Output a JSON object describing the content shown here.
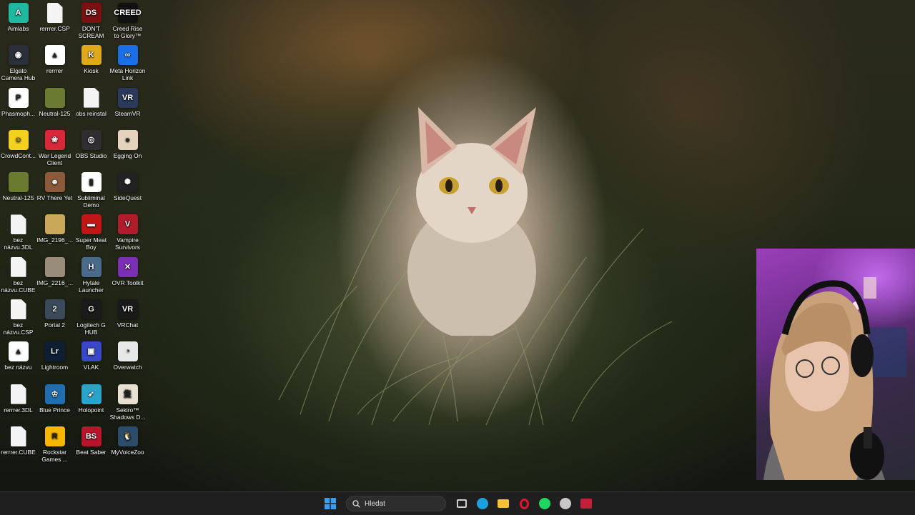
{
  "desktop": {
    "icons": [
      {
        "label": "Aimlabs",
        "kind": "app",
        "glyph": "A",
        "color": "#1fb8a0"
      },
      {
        "label": "rerrrer.CSP",
        "kind": "file",
        "glyph": "",
        "color": "#f4f4f4"
      },
      {
        "label": "DON'T SCREAM",
        "kind": "app",
        "glyph": "DS",
        "color": "#7a1010"
      },
      {
        "label": "Creed Rise to Glory™",
        "kind": "app",
        "glyph": "CREED",
        "color": "#111111"
      },
      {
        "label": "Elgato Camera Hub",
        "kind": "app",
        "glyph": "◉",
        "color": "#2a2f3a"
      },
      {
        "label": "rerrrer",
        "kind": "app",
        "glyph": "▲",
        "color": "#ffffff"
      },
      {
        "label": "Kiosk",
        "kind": "app",
        "glyph": "K",
        "color": "#e0a91c"
      },
      {
        "label": "Meta Horizon Link",
        "kind": "app",
        "glyph": "∞",
        "color": "#1a6fe8"
      },
      {
        "label": "Phasmoph...",
        "kind": "app",
        "glyph": "P",
        "color": "#ffffff"
      },
      {
        "label": "Neutral-125",
        "kind": "app",
        "glyph": "",
        "color": "#6a7a30"
      },
      {
        "label": "obs reinstal",
        "kind": "file",
        "glyph": "",
        "color": "#f4f4f4"
      },
      {
        "label": "SteamVR",
        "kind": "app",
        "glyph": "VR",
        "color": "#2b3a5c"
      },
      {
        "label": "CrowdCont...",
        "kind": "app",
        "glyph": "☺",
        "color": "#f2d21c"
      },
      {
        "label": "War Legend Client",
        "kind": "app",
        "glyph": "❀",
        "color": "#d8283a"
      },
      {
        "label": "OBS Studio",
        "kind": "app",
        "glyph": "◎",
        "color": "#302e31"
      },
      {
        "label": "Egging On",
        "kind": "app",
        "glyph": "●",
        "color": "#e6d3bd"
      },
      {
        "label": "Neutral-125",
        "kind": "app",
        "glyph": "",
        "color": "#6a7a30"
      },
      {
        "label": "RV There Yet",
        "kind": "app",
        "glyph": "☻",
        "color": "#8a5a3a"
      },
      {
        "label": "Subliminal Demo",
        "kind": "app",
        "glyph": "▮",
        "color": "#ffffff"
      },
      {
        "label": "SideQuest",
        "kind": "app",
        "glyph": "✺",
        "color": "#222222"
      },
      {
        "label": "bez názvu.3DL",
        "kind": "file",
        "glyph": "",
        "color": "#f4f4f4"
      },
      {
        "label": "IMG_2196_...",
        "kind": "app",
        "glyph": "",
        "color": "#c9a85a"
      },
      {
        "label": "Super Meat Boy",
        "kind": "app",
        "glyph": "▬",
        "color": "#c01616"
      },
      {
        "label": "Vampire Survivors",
        "kind": "app",
        "glyph": "V",
        "color": "#b01c2a"
      },
      {
        "label": "bez názvu.CUBE",
        "kind": "file",
        "glyph": "",
        "color": "#f4f4f4"
      },
      {
        "label": "IMG_2216_...",
        "kind": "app",
        "glyph": "",
        "color": "#9a8c7a"
      },
      {
        "label": "Hytale Launcher",
        "kind": "app",
        "glyph": "H",
        "color": "#4a6a8a"
      },
      {
        "label": "OVR Toolkit",
        "kind": "app",
        "glyph": "✕",
        "color": "#7b2fb5"
      },
      {
        "label": "bez názvu.CSP",
        "kind": "file",
        "glyph": "",
        "color": "#f4f4f4"
      },
      {
        "label": "Portal 2",
        "kind": "app",
        "glyph": "2",
        "color": "#3a4a5a"
      },
      {
        "label": "Logitech G HUB",
        "kind": "app",
        "glyph": "G",
        "color": "#1a1a1a"
      },
      {
        "label": "VRChat",
        "kind": "app",
        "glyph": "VR",
        "color": "#1a1a1a"
      },
      {
        "label": "bez názvu",
        "kind": "app",
        "glyph": "▲",
        "color": "#ffffff"
      },
      {
        "label": "Lightroom",
        "kind": "app",
        "glyph": "Lr",
        "color": "#0c1f33"
      },
      {
        "label": "VLAK",
        "kind": "app",
        "glyph": "▣",
        "color": "#3a48c8"
      },
      {
        "label": "Overwatch",
        "kind": "app",
        "glyph": "◔",
        "color": "#e8e8e8"
      },
      {
        "label": "rerrrer.3DL",
        "kind": "file",
        "glyph": "",
        "color": "#f4f4f4"
      },
      {
        "label": "Blue Prince",
        "kind": "app",
        "glyph": "♔",
        "color": "#1f6fb0"
      },
      {
        "label": "Holopoint",
        "kind": "app",
        "glyph": "➶",
        "color": "#2aa4c8"
      },
      {
        "label": "Sekiro™ Shadows D...",
        "kind": "app",
        "glyph": "隻",
        "color": "#e8e0d0"
      },
      {
        "label": "rerrrer.CUBE",
        "kind": "file",
        "glyph": "",
        "color": "#f4f4f4"
      },
      {
        "label": "Rockstar Games ...",
        "kind": "app",
        "glyph": "R",
        "color": "#f5b700"
      },
      {
        "label": "Beat Saber",
        "kind": "app",
        "glyph": "BS",
        "color": "#b8152a"
      },
      {
        "label": "MyVoiceZoo",
        "kind": "app",
        "glyph": "🐧",
        "color": "#2c4c6c"
      }
    ]
  },
  "taskbar": {
    "start_icon": "windows-start-icon",
    "search_placeholder": "Hledat",
    "pinned": [
      {
        "name": "task-view-icon",
        "color": "#cfcfcf"
      },
      {
        "name": "edge-icon",
        "color": "#1ba0e0"
      },
      {
        "name": "file-explorer-icon",
        "color": "#f2c233"
      },
      {
        "name": "opera-icon",
        "color": "#e0162b"
      },
      {
        "name": "spotify-icon",
        "color": "#1ed760"
      },
      {
        "name": "steam-icon",
        "color": "#c8c8c8"
      },
      {
        "name": "app-icon",
        "color": "#c0203a"
      }
    ]
  }
}
